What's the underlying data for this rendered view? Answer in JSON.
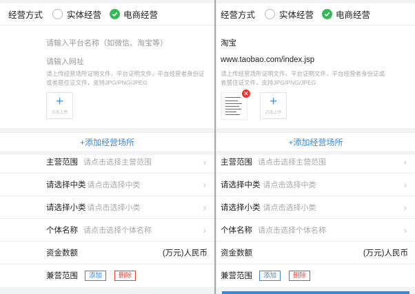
{
  "left": {
    "business_mode": {
      "label": "经营方式",
      "option_physical": "实体经营",
      "option_ecommerce": "电商经营"
    },
    "platform_name": {
      "placeholder": "请输入平台名称（如微信、淘宝等）"
    },
    "website": {
      "placeholder": "请输入网址"
    },
    "upload_hint": "请上传经营场所证明文件，平台证明文件，平台经营者身份证或者居住证文件，支持JPG/PNG/JPEG",
    "upload_label": "点击上传",
    "add_place": "+添加经营场所",
    "rows": [
      {
        "label": "主营范围",
        "placeholder": "请点击选择主营范围"
      },
      {
        "label": "请选择中类",
        "placeholder": "请点击选择中类"
      },
      {
        "label": "请选择小类",
        "placeholder": "请点击选择小类"
      },
      {
        "label": "个体名称",
        "placeholder": "请点击选择个体名称"
      }
    ],
    "capital": {
      "label": "资金数额",
      "unit": "(万元)人民币"
    },
    "side_business": {
      "label": "兼营范围",
      "add": "添加",
      "delete": "删除"
    }
  },
  "right": {
    "business_mode": {
      "label": "经营方式",
      "option_physical": "实体经营",
      "option_ecommerce": "电商经营"
    },
    "platform_name": {
      "value": "淘宝"
    },
    "website": {
      "value": "www.taobao.com/index.jsp"
    },
    "upload_hint": "请上传经营场所证明文件，平台证明文件，平台经营者身份证或者居住证文件，支持JPG/PNG/JPEG",
    "upload_label": "点击上传",
    "add_place": "+添加经营场所",
    "rows": [
      {
        "label": "主营范围",
        "placeholder": "请点击选择主营范围"
      },
      {
        "label": "请选择中类",
        "placeholder": "请点击选择中类"
      },
      {
        "label": "请选择小类",
        "placeholder": "请点击选择小类"
      },
      {
        "label": "个体名称",
        "placeholder": "请点击选择个体名称"
      }
    ],
    "capital": {
      "label": "资金数额",
      "unit": "(万元)人民币"
    },
    "side_business": {
      "label": "兼营范围",
      "add": "添加",
      "delete": "删除"
    }
  },
  "colors": {
    "accent": "#3b88d4",
    "selected_radio": "#38b65a",
    "delete": "#e0453c"
  },
  "icons": {
    "chevron": "chevron-right-icon",
    "check": "check-icon",
    "plus": "plus-icon",
    "remove": "remove-image-icon"
  }
}
